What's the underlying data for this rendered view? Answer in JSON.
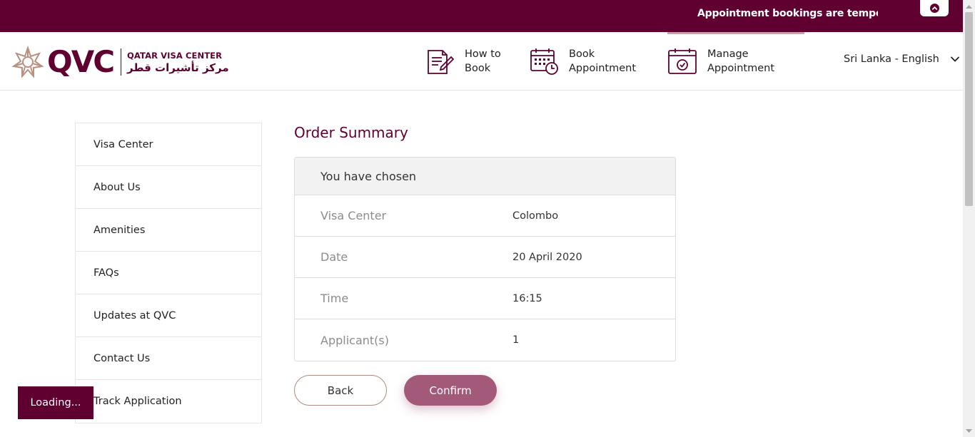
{
  "banner": {
    "message": "Appointment bookings are tempora"
  },
  "brand": {
    "short": "QVC",
    "name_en": "QATAR VISA CENTER",
    "name_ar": "مركز تأشيرات قطر",
    "primary_color": "#5f0030",
    "accent_color": "#a35a7a"
  },
  "nav": {
    "items": [
      {
        "line1": "How to",
        "line2": "Book",
        "icon": "document-pen-icon"
      },
      {
        "line1": "Book",
        "line2": "Appointment",
        "icon": "calendar-clock-icon"
      },
      {
        "line1": "Manage",
        "line2": "Appointment",
        "icon": "calendar-check-icon",
        "active": true
      }
    ],
    "language": "Sri Lanka - English"
  },
  "sidebar": {
    "items": [
      {
        "label": "Visa Center"
      },
      {
        "label": "About Us"
      },
      {
        "label": "Amenities"
      },
      {
        "label": "FAQs"
      },
      {
        "label": "Updates at QVC"
      },
      {
        "label": "Contact Us"
      },
      {
        "label": "Track Application"
      }
    ]
  },
  "main": {
    "title": "Order Summary",
    "summary_header": "You have chosen",
    "rows": [
      {
        "key": "Visa Center",
        "value": "Colombo"
      },
      {
        "key": "Date",
        "value": "20 April 2020"
      },
      {
        "key": "Time",
        "value": "16:15"
      },
      {
        "key": "Applicant(s)",
        "value": "1"
      }
    ],
    "back_label": "Back",
    "confirm_label": "Confirm"
  },
  "status": {
    "loading": "Loading..."
  }
}
